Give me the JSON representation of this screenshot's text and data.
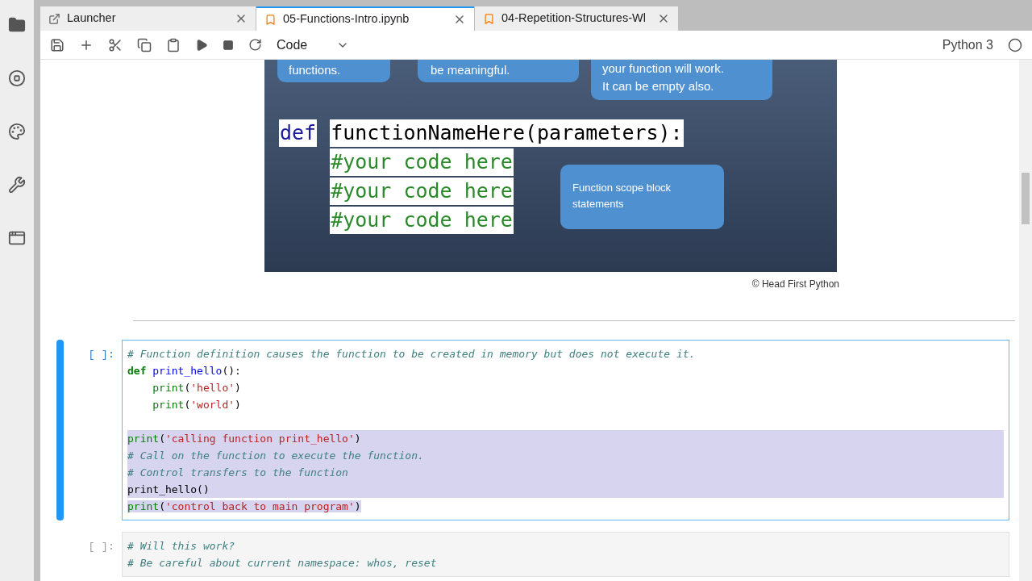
{
  "tabs": [
    {
      "label": "Launcher",
      "kind": "launcher",
      "selected": false
    },
    {
      "label": "05-Functions-Intro.ipynb",
      "kind": "notebook",
      "selected": true
    },
    {
      "label": "04-Repetition-Structures-Wl",
      "kind": "notebook",
      "selected": false
    }
  ],
  "toolbar": {
    "cell_type": "Code",
    "kernel": "Python 3"
  },
  "slide": {
    "callouts": [
      {
        "kind": "left",
        "lines": [
          "functions."
        ]
      },
      {
        "kind": "middle",
        "lines": [
          "be meaningful."
        ]
      },
      {
        "kind": "right",
        "lines": [
          "your function will work.",
          "It can be empty also."
        ]
      },
      {
        "kind": "scope",
        "lines": [
          "Function scope block",
          "statements"
        ]
      }
    ],
    "keyword": "def",
    "signature": "functionNameHere(parameters):",
    "body": [
      "#your code here",
      "#your code here",
      "#your code here"
    ],
    "caption": "© Head First Python"
  },
  "cells": [
    {
      "prompt": "[ ]:",
      "active": true,
      "lines": [
        {
          "selected": false,
          "tokens": [
            {
              "kind": "comment",
              "text": "# Function definition causes the function to be created in memory but does not execute it."
            }
          ]
        },
        {
          "selected": false,
          "tokens": [
            {
              "kind": "keyword",
              "text": "def"
            },
            {
              "kind": "defname",
              "text": "print_hello"
            },
            {
              "kind": "plain",
              "text": "():"
            }
          ]
        },
        {
          "selected": false,
          "indent": true,
          "tokens": [
            {
              "kind": "builtin",
              "text": "print"
            },
            {
              "kind": "plain",
              "text": "("
            },
            {
              "kind": "string",
              "text": "'hello'"
            },
            {
              "kind": "plain",
              "text": ")"
            }
          ]
        },
        {
          "selected": false,
          "indent": true,
          "tokens": [
            {
              "kind": "builtin",
              "text": "print"
            },
            {
              "kind": "plain",
              "text": "("
            },
            {
              "kind": "string",
              "text": "'world'"
            },
            {
              "kind": "plain",
              "text": ")"
            }
          ]
        },
        {
          "selected": false
        },
        {
          "selected": true,
          "tokens": [
            {
              "kind": "builtin",
              "text": "print"
            },
            {
              "kind": "plain",
              "text": "("
            },
            {
              "kind": "string",
              "text": "'calling function print_hello'"
            },
            {
              "kind": "plain",
              "text": ")"
            }
          ]
        },
        {
          "selected": true,
          "tokens": [
            {
              "kind": "comment",
              "text": "# Call on the function to execute the function."
            }
          ]
        },
        {
          "selected": true,
          "tokens": [
            {
              "kind": "comment",
              "text": "# Control transfers to the function"
            }
          ]
        },
        {
          "selected": true,
          "tokens": [
            {
              "kind": "plain",
              "text": "print_hello()"
            }
          ]
        },
        {
          "selected": false,
          "partial": true,
          "tokens": [
            {
              "kind": "builtin",
              "text": "print"
            },
            {
              "kind": "plain",
              "text": "("
            },
            {
              "kind": "string",
              "text": "'control back to main program'"
            },
            {
              "kind": "plain",
              "text": ")"
            }
          ]
        }
      ]
    },
    {
      "prompt": "[ ]:",
      "active": false,
      "lines": [
        {
          "selected": false,
          "tokens": [
            {
              "kind": "comment",
              "text": "# Will this work?"
            }
          ]
        },
        {
          "selected": false,
          "tokens": [
            {
              "kind": "comment",
              "text": "# Be careful about current namespace: whos, reset"
            }
          ]
        }
      ]
    }
  ]
}
